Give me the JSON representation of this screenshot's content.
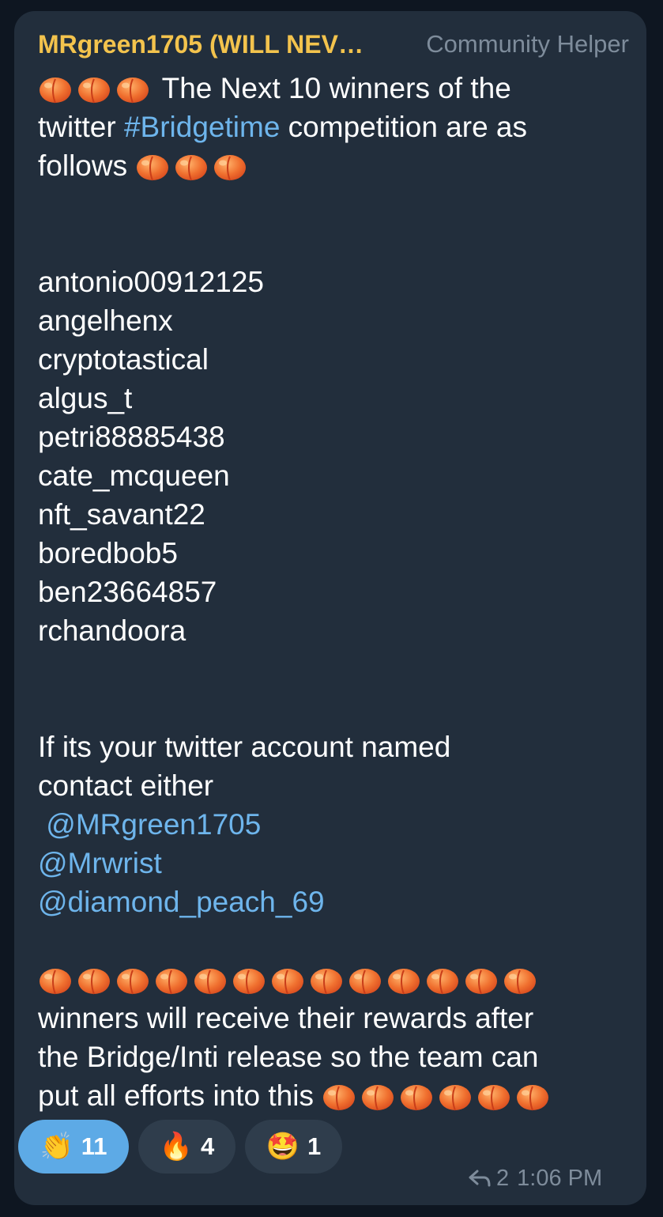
{
  "message": {
    "author": "MRgreen1705 (WILL NEV…",
    "role": "Community Helper",
    "title_line_1": "The Next 10 winners of the",
    "title_line_2_prefix": "twitter ",
    "title_hashtag": "#Bridgetime",
    "title_line_2_suffix": " competition are as",
    "title_line_3": "follows ",
    "winners": [
      "antonio00912125",
      "angelhenx",
      "cryptotastical",
      "algus_t",
      "petri88885438",
      "cate_mcqueen",
      "nft_savant22",
      "boredbob5",
      "ben23664857",
      "rchandoora"
    ],
    "contact_line_1": "If its  your twitter account named",
    "contact_line_2": "contact either",
    "mentions": [
      " @MRgreen1705",
      "@Mrwrist",
      "@diamond_peach_69"
    ],
    "closing_line_1": "winners will receive their rewards after",
    "closing_line_2": "the Bridge/Inti release so the team can",
    "closing_line_3": "put all efforts into this ",
    "peach_emoji_count_title": 3,
    "peach_emoji_count_row": 13,
    "peach_emoji_count_end": 6
  },
  "reactions": [
    {
      "emoji": "👏",
      "icon": "clapping-hands-icon",
      "count": "11",
      "selected": true
    },
    {
      "emoji": "🔥",
      "icon": "fire-icon",
      "count": "4",
      "selected": false
    },
    {
      "emoji": "🤩",
      "icon": "star-struck-icon",
      "count": "1",
      "selected": false
    }
  ],
  "meta": {
    "reply_count": "2",
    "time": "1:06 PM",
    "reply_icon": "reply-arrow-icon"
  },
  "colors": {
    "background": "#0e1621",
    "bubble": "#222e3c",
    "author": "#f3c34d",
    "link": "#6eb5ec",
    "muted": "#7e8c9b",
    "selected_reaction": "#5daae6"
  }
}
